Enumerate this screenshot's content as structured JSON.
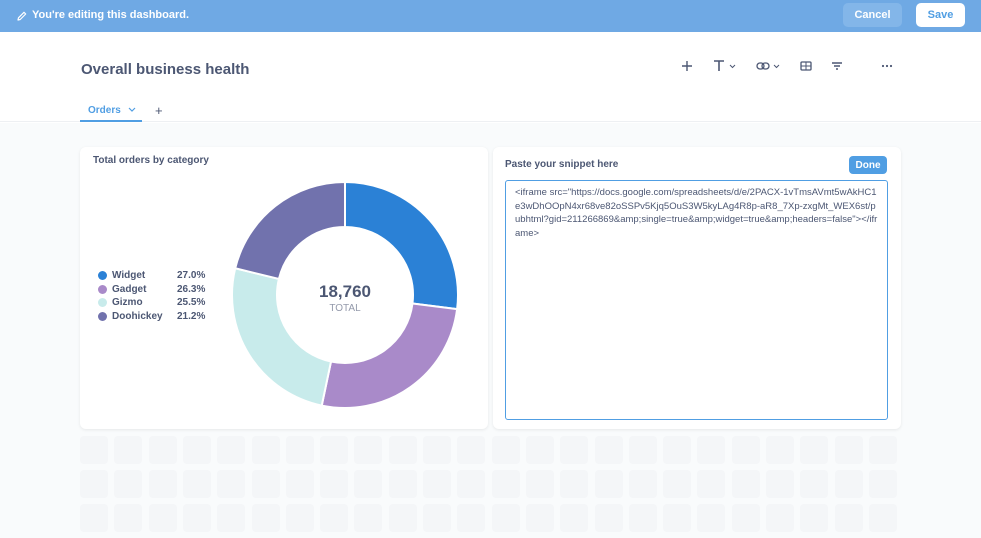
{
  "edit_bar": {
    "message": "You're editing this dashboard.",
    "cancel_label": "Cancel",
    "save_label": "Save",
    "background_color": "#6fa9e4"
  },
  "header": {
    "title": "Overall business health",
    "toolbar_icons": [
      "plus-icon",
      "text-icon",
      "link-icon",
      "section-icon",
      "filter-icon",
      "more-icon"
    ],
    "tabs": [
      {
        "label": "Orders"
      }
    ],
    "add_tab_label": "+"
  },
  "chart_card": {
    "title": "Total orders by category",
    "total_value": "18,760",
    "total_label": "TOTAL"
  },
  "chart_data": {
    "type": "pie",
    "title": "Total orders by category",
    "categories": [
      "Widget",
      "Gadget",
      "Gizmo",
      "Doohickey"
    ],
    "values": [
      27.0,
      26.3,
      25.5,
      21.2
    ],
    "value_labels": [
      "27.0%",
      "26.3%",
      "25.5%",
      "21.2%"
    ],
    "colors": [
      "#2b81d6",
      "#a98ac9",
      "#c8ebeb",
      "#7172ad"
    ],
    "total": 18760,
    "donut": true,
    "legend_placement": "left"
  },
  "snippet_card": {
    "title": "Paste your snippet here",
    "done_label": "Done",
    "snippet": "<iframe src=\"https://docs.google.com/spreadsheets/d/e/2PACX-1vTmsAVmt5wAkHC1e3wDhOOpN4xr68ve82oSSPv5Kjq5OuS3W5kyLAg4R8p-aR8_7Xp-zxgMt_WEX6st/pubhtml?gid=211266869&amp;single=true&amp;widget=true&amp;headers=false\"></iframe>"
  }
}
